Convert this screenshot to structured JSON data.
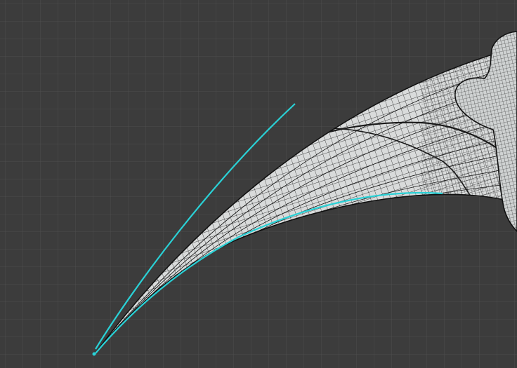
{
  "viewport": {
    "background_color": "#3c3c3c",
    "grid_color": "#4d4d4d",
    "shown_grid": true
  },
  "model": {
    "object_type": "karambit blade",
    "display_mode": "wireframe",
    "surface_color": "#d9dbdb",
    "wire_color": "#151515",
    "outline_color": "#111111",
    "selection_color": "#2ad1d6",
    "selected_edges": [
      "upper-spine-edge",
      "lower-cutting-edge",
      "blade-tip"
    ]
  }
}
